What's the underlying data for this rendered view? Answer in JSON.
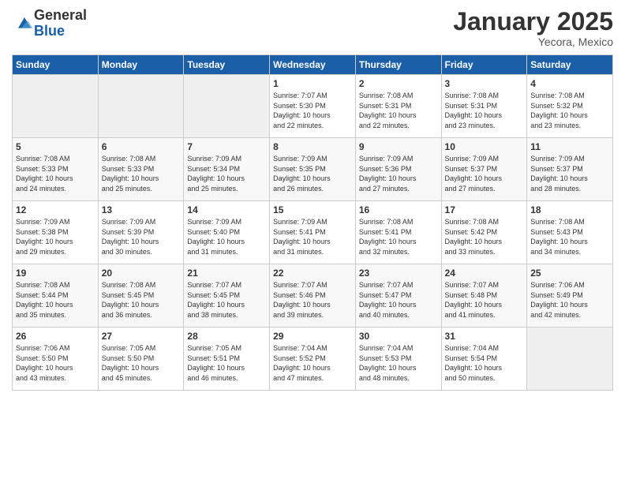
{
  "logo": {
    "general": "General",
    "blue": "Blue"
  },
  "header": {
    "month": "January 2025",
    "location": "Yecora, Mexico"
  },
  "weekdays": [
    "Sunday",
    "Monday",
    "Tuesday",
    "Wednesday",
    "Thursday",
    "Friday",
    "Saturday"
  ],
  "weeks": [
    [
      {
        "day": "",
        "info": ""
      },
      {
        "day": "",
        "info": ""
      },
      {
        "day": "",
        "info": ""
      },
      {
        "day": "1",
        "info": "Sunrise: 7:07 AM\nSunset: 5:30 PM\nDaylight: 10 hours\nand 22 minutes."
      },
      {
        "day": "2",
        "info": "Sunrise: 7:08 AM\nSunset: 5:31 PM\nDaylight: 10 hours\nand 22 minutes."
      },
      {
        "day": "3",
        "info": "Sunrise: 7:08 AM\nSunset: 5:31 PM\nDaylight: 10 hours\nand 23 minutes."
      },
      {
        "day": "4",
        "info": "Sunrise: 7:08 AM\nSunset: 5:32 PM\nDaylight: 10 hours\nand 23 minutes."
      }
    ],
    [
      {
        "day": "5",
        "info": "Sunrise: 7:08 AM\nSunset: 5:33 PM\nDaylight: 10 hours\nand 24 minutes."
      },
      {
        "day": "6",
        "info": "Sunrise: 7:08 AM\nSunset: 5:33 PM\nDaylight: 10 hours\nand 25 minutes."
      },
      {
        "day": "7",
        "info": "Sunrise: 7:09 AM\nSunset: 5:34 PM\nDaylight: 10 hours\nand 25 minutes."
      },
      {
        "day": "8",
        "info": "Sunrise: 7:09 AM\nSunset: 5:35 PM\nDaylight: 10 hours\nand 26 minutes."
      },
      {
        "day": "9",
        "info": "Sunrise: 7:09 AM\nSunset: 5:36 PM\nDaylight: 10 hours\nand 27 minutes."
      },
      {
        "day": "10",
        "info": "Sunrise: 7:09 AM\nSunset: 5:37 PM\nDaylight: 10 hours\nand 27 minutes."
      },
      {
        "day": "11",
        "info": "Sunrise: 7:09 AM\nSunset: 5:37 PM\nDaylight: 10 hours\nand 28 minutes."
      }
    ],
    [
      {
        "day": "12",
        "info": "Sunrise: 7:09 AM\nSunset: 5:38 PM\nDaylight: 10 hours\nand 29 minutes."
      },
      {
        "day": "13",
        "info": "Sunrise: 7:09 AM\nSunset: 5:39 PM\nDaylight: 10 hours\nand 30 minutes."
      },
      {
        "day": "14",
        "info": "Sunrise: 7:09 AM\nSunset: 5:40 PM\nDaylight: 10 hours\nand 31 minutes."
      },
      {
        "day": "15",
        "info": "Sunrise: 7:09 AM\nSunset: 5:41 PM\nDaylight: 10 hours\nand 31 minutes."
      },
      {
        "day": "16",
        "info": "Sunrise: 7:08 AM\nSunset: 5:41 PM\nDaylight: 10 hours\nand 32 minutes."
      },
      {
        "day": "17",
        "info": "Sunrise: 7:08 AM\nSunset: 5:42 PM\nDaylight: 10 hours\nand 33 minutes."
      },
      {
        "day": "18",
        "info": "Sunrise: 7:08 AM\nSunset: 5:43 PM\nDaylight: 10 hours\nand 34 minutes."
      }
    ],
    [
      {
        "day": "19",
        "info": "Sunrise: 7:08 AM\nSunset: 5:44 PM\nDaylight: 10 hours\nand 35 minutes."
      },
      {
        "day": "20",
        "info": "Sunrise: 7:08 AM\nSunset: 5:45 PM\nDaylight: 10 hours\nand 36 minutes."
      },
      {
        "day": "21",
        "info": "Sunrise: 7:07 AM\nSunset: 5:45 PM\nDaylight: 10 hours\nand 38 minutes."
      },
      {
        "day": "22",
        "info": "Sunrise: 7:07 AM\nSunset: 5:46 PM\nDaylight: 10 hours\nand 39 minutes."
      },
      {
        "day": "23",
        "info": "Sunrise: 7:07 AM\nSunset: 5:47 PM\nDaylight: 10 hours\nand 40 minutes."
      },
      {
        "day": "24",
        "info": "Sunrise: 7:07 AM\nSunset: 5:48 PM\nDaylight: 10 hours\nand 41 minutes."
      },
      {
        "day": "25",
        "info": "Sunrise: 7:06 AM\nSunset: 5:49 PM\nDaylight: 10 hours\nand 42 minutes."
      }
    ],
    [
      {
        "day": "26",
        "info": "Sunrise: 7:06 AM\nSunset: 5:50 PM\nDaylight: 10 hours\nand 43 minutes."
      },
      {
        "day": "27",
        "info": "Sunrise: 7:05 AM\nSunset: 5:50 PM\nDaylight: 10 hours\nand 45 minutes."
      },
      {
        "day": "28",
        "info": "Sunrise: 7:05 AM\nSunset: 5:51 PM\nDaylight: 10 hours\nand 46 minutes."
      },
      {
        "day": "29",
        "info": "Sunrise: 7:04 AM\nSunset: 5:52 PM\nDaylight: 10 hours\nand 47 minutes."
      },
      {
        "day": "30",
        "info": "Sunrise: 7:04 AM\nSunset: 5:53 PM\nDaylight: 10 hours\nand 48 minutes."
      },
      {
        "day": "31",
        "info": "Sunrise: 7:04 AM\nSunset: 5:54 PM\nDaylight: 10 hours\nand 50 minutes."
      },
      {
        "day": "",
        "info": ""
      }
    ]
  ]
}
